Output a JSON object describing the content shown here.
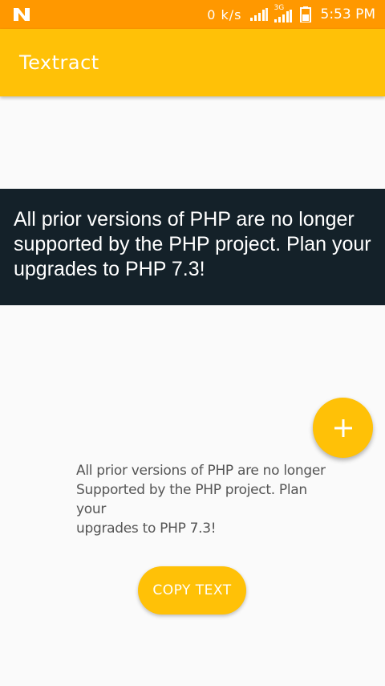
{
  "status_bar": {
    "net_speed": "0 k/s",
    "network_type": "3G",
    "time": "5:53 PM"
  },
  "app_bar": {
    "title": "Textract"
  },
  "captured_image": {
    "text": "All prior versions of PHP are no longer supported by the PHP project. Plan your upgrades to PHP 7.3!"
  },
  "fab": {
    "icon": "plus-icon"
  },
  "result": {
    "lines": [
      "All prior versions of PHP are no longer",
      "Supported by the PHP project. Plan your",
      "upgrades to PHP 7.3!"
    ]
  },
  "copy_button": {
    "label": "COPY TEXT"
  },
  "colors": {
    "status_bar": "#ff9800",
    "accent": "#ffc107",
    "image_background": "#142129"
  }
}
